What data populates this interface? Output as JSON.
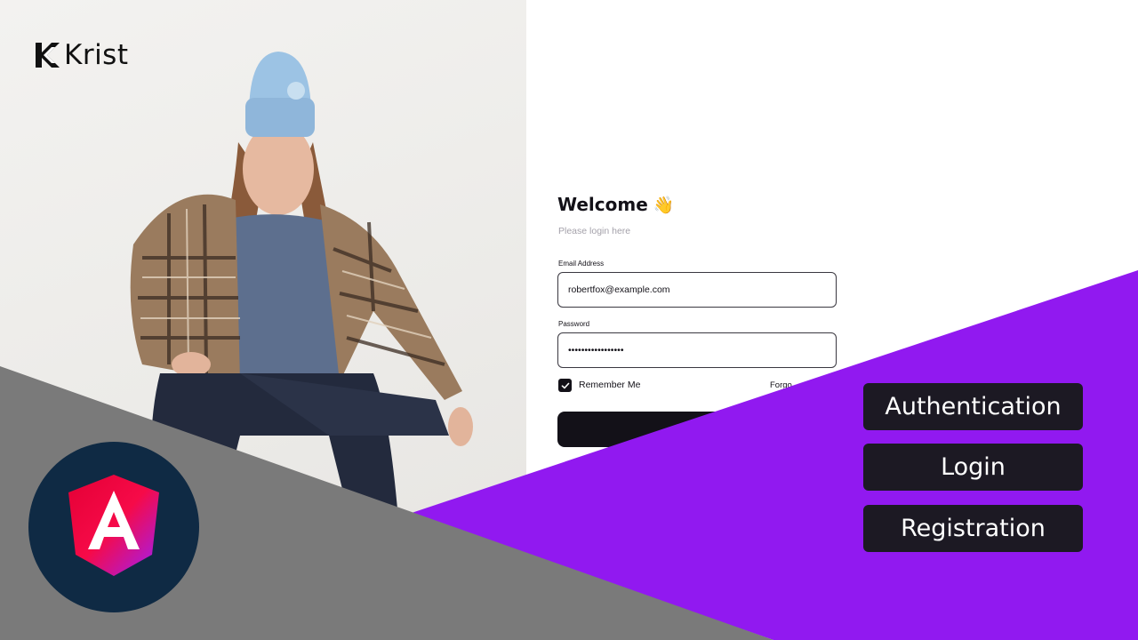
{
  "brand": {
    "name": "Krist"
  },
  "login": {
    "title": "Welcome",
    "wave_emoji": "👋",
    "subtitle": "Please login here",
    "email_label": "Email Address",
    "email_value": "robertfox@example.com",
    "password_label": "Password",
    "password_value": "•••••••••••••••••",
    "remember_label": "Remember Me",
    "remember_checked": true,
    "forgot_label": "Forgo"
  },
  "tags": {
    "authentication": "Authentication",
    "login": "Login",
    "registration": "Registration"
  },
  "colors": {
    "purple": "#9119f0",
    "gray": "#7a7a7a",
    "badge_bg": "#0f2a44",
    "tag_bg": "#1c1923",
    "form_dark": "#131118"
  },
  "icons": [
    "krist-logo-icon",
    "waving-hand-icon",
    "checkmark-icon",
    "angular-logo-icon"
  ]
}
